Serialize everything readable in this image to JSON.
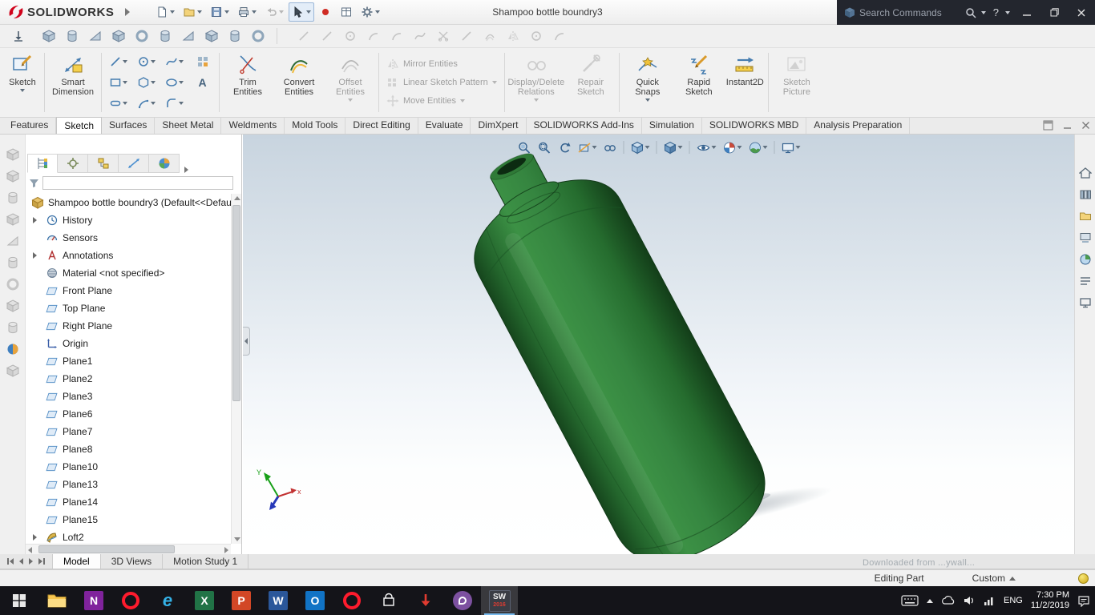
{
  "titlebar": {
    "logo_text": "SOLIDWORKS",
    "title": "Shampoo bottle boundry3",
    "search_placeholder": "Search Commands",
    "help_label": "?"
  },
  "command_tabs": {
    "items": [
      "Features",
      "Sketch",
      "Surfaces",
      "Sheet Metal",
      "Weldments",
      "Mold Tools",
      "Direct Editing",
      "Evaluate",
      "DimXpert",
      "SOLIDWORKS Add-Ins",
      "Simulation",
      "SOLIDWORKS MBD",
      "Analysis Preparation"
    ]
  },
  "ribbon": {
    "sketch": "Sketch",
    "smart_dimension": "Smart Dimension",
    "text_tool": "A",
    "trim": "Trim Entities",
    "convert": "Convert Entities",
    "offset": "Offset Entities",
    "mirror": "Mirror Entities",
    "linear_pattern": "Linear Sketch Pattern",
    "move": "Move Entities",
    "relations": "Display/Delete Relations",
    "repair": "Repair Sketch",
    "quick_snaps": "Quick Snaps",
    "rapid_sketch": "Rapid Sketch",
    "instant2d": "Instant2D",
    "sketch_picture": "Sketch Picture"
  },
  "feature_tree": {
    "root": "Shampoo bottle boundry3  (Default<<Defau",
    "items": [
      "History",
      "Sensors",
      "Annotations",
      "Material <not specified>",
      "Front Plane",
      "Top Plane",
      "Right Plane",
      "Origin",
      "Plane1",
      "Plane2",
      "Plane3",
      "Plane6",
      "Plane7",
      "Plane8",
      "Plane10",
      "Plane13",
      "Plane14",
      "Plane15",
      "Loft2"
    ]
  },
  "viewport": {
    "triad_x": "x",
    "triad_y": "Y",
    "watermark": "Downloaded from ...ywall..."
  },
  "model_tabs": {
    "items": [
      "Model",
      "3D Views",
      "Motion Study 1"
    ]
  },
  "statusbar": {
    "mode": "Editing Part",
    "units": "Custom"
  },
  "taskbar": {
    "onenote_letter": "N",
    "ie_letter": "e",
    "excel_letter": "X",
    "powerpoint_letter": "P",
    "word_letter": "W",
    "outlook_letter": "O",
    "sw_letter": "SW",
    "sw_year": "2016",
    "lang": "ENG",
    "time": "7:30 PM",
    "date": "11/2/2019"
  }
}
